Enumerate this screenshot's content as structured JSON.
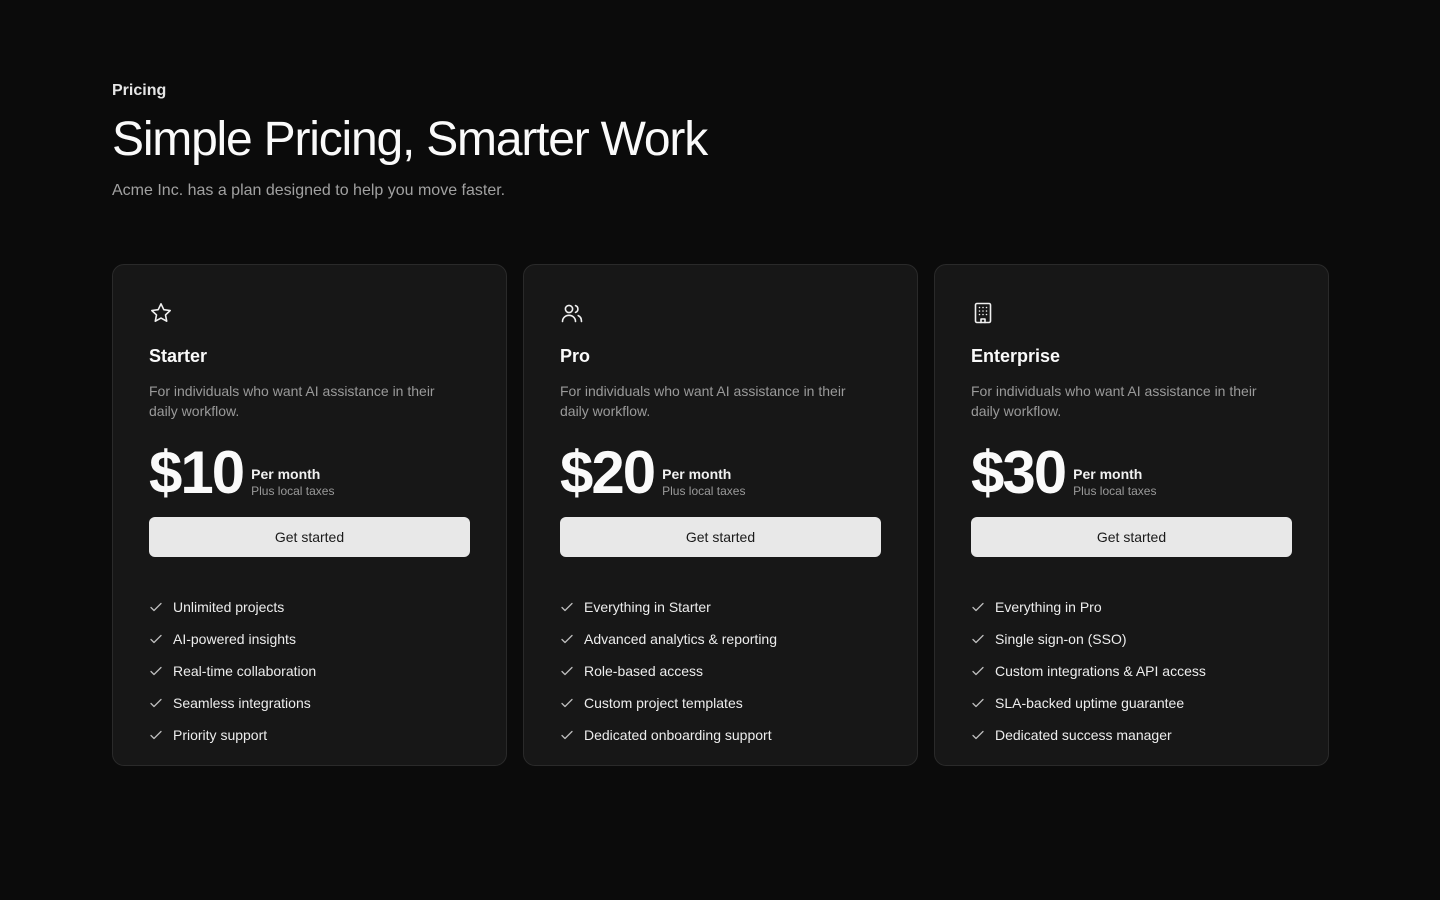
{
  "header": {
    "eyebrow": "Pricing",
    "title": "Simple Pricing, Smarter Work",
    "subtitle": "Acme Inc. has a plan designed to help you move faster."
  },
  "plans": [
    {
      "icon": "star-icon",
      "name": "Starter",
      "description": "For individuals who want AI assistance in their daily workflow.",
      "price": "$10",
      "period": "Per month",
      "tax_note": "Plus local taxes",
      "cta": "Get started",
      "features": [
        "Unlimited projects",
        "AI-powered insights",
        "Real-time collaboration",
        "Seamless integrations",
        "Priority support"
      ]
    },
    {
      "icon": "users-icon",
      "name": "Pro",
      "description": "For individuals who want AI assistance in their daily workflow.",
      "price": "$20",
      "period": "Per month",
      "tax_note": "Plus local taxes",
      "cta": "Get started",
      "features": [
        "Everything in Starter",
        "Advanced analytics & reporting",
        "Role-based access",
        "Custom project templates",
        "Dedicated onboarding support"
      ]
    },
    {
      "icon": "building-icon",
      "name": "Enterprise",
      "description": "For individuals who want AI assistance in their daily workflow.",
      "price": "$30",
      "period": "Per month",
      "tax_note": "Plus local taxes",
      "cta": "Get started",
      "features": [
        "Everything in Pro",
        "Single sign-on (SSO)",
        "Custom integrations & API access",
        "SLA-backed uptime guarantee",
        "Dedicated success manager"
      ]
    }
  ],
  "colors": {
    "background": "#0b0b0b",
    "card": "#171717",
    "card_border": "#2a2a2a",
    "button": "#e8e8e8",
    "muted_text": "#9a9a9a"
  }
}
